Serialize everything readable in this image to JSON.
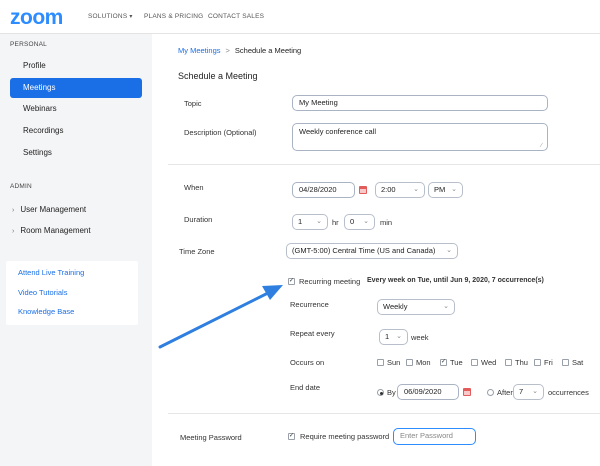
{
  "header": {
    "logo": "zoom",
    "nav": [
      "SOLUTIONS",
      "PLANS & PRICING",
      "CONTACT SALES"
    ]
  },
  "sidebar": {
    "personal_label": "PERSONAL",
    "personal_items": [
      "Profile",
      "Meetings",
      "Webinars",
      "Recordings",
      "Settings"
    ],
    "admin_label": "ADMIN",
    "admin_items": [
      "User Management",
      "Room Management"
    ],
    "links": [
      "Attend Live Training",
      "Video Tutorials",
      "Knowledge Base"
    ]
  },
  "breadcrumb": {
    "parent": "My Meetings",
    "separator": ">",
    "current": "Schedule a Meeting"
  },
  "page_title": "Schedule a Meeting",
  "form": {
    "topic_label": "Topic",
    "topic_value": "My Meeting",
    "description_label": "Description (Optional)",
    "description_value": "Weekly conference call",
    "when_label": "When",
    "date_value": "04/28/2020",
    "time_value": "2:00",
    "ampm_value": "PM",
    "duration_label": "Duration",
    "duration_hr": "1",
    "hr_label": "hr",
    "duration_min": "0",
    "min_label": "min",
    "timezone_label": "Time Zone",
    "timezone_value": "(GMT-5:00) Central Time (US and Canada)",
    "recurring_label": "Recurring meeting",
    "recurring_summary": "Every week on Tue, until Jun 9, 2020, 7 occurrence(s)",
    "recurrence_label": "Recurrence",
    "recurrence_value": "Weekly",
    "repeat_label": "Repeat every",
    "repeat_value": "1",
    "repeat_unit": "week",
    "occurs_label": "Occurs on",
    "days": [
      "Sun",
      "Mon",
      "Tue",
      "Wed",
      "Thu",
      "Fri",
      "Sat"
    ],
    "end_label": "End date",
    "by_label": "By",
    "end_date_value": "06/09/2020",
    "after_label": "After",
    "after_value": "7",
    "occurrences_label": "occurrences",
    "password_label": "Meeting Password",
    "require_password_label": "Require meeting password",
    "password_placeholder": "Enter Password"
  },
  "colors": {
    "brand": "#2d8cff",
    "active": "#1a6fe6",
    "arrow": "#2f7fe0"
  }
}
